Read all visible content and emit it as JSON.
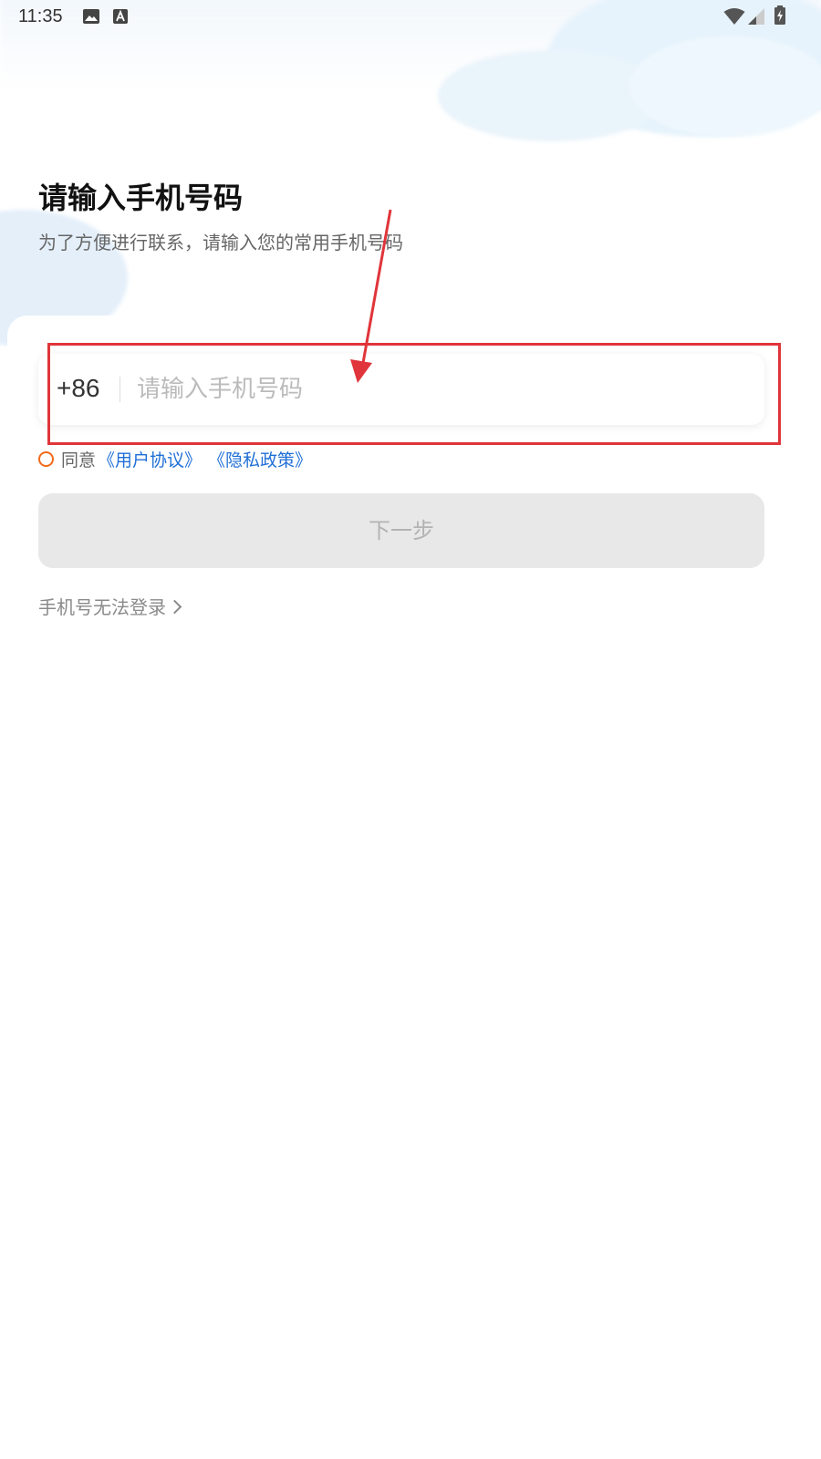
{
  "status_bar": {
    "time": "11:35",
    "icons": [
      "image-icon",
      "text-a-icon",
      "wifi-icon",
      "signal-icon",
      "battery-icon"
    ]
  },
  "header": {
    "title": "请输入手机号码",
    "subtitle": "为了方便进行联系，请输入您的常用手机号码"
  },
  "phone_input": {
    "country_code": "+86",
    "placeholder": "请输入手机号码",
    "value": ""
  },
  "agreement": {
    "checked": false,
    "prefix": "同意",
    "user_agreement": "《用户协议》",
    "privacy_policy": "《隐私政策》"
  },
  "next_button": {
    "label": "下一步",
    "enabled": false
  },
  "help": {
    "label": "手机号无法登录"
  },
  "colors": {
    "accent_link": "#1f6fd6",
    "radio_orange": "#f26a1b",
    "annotation_red": "#e0353a",
    "disabled_button": "#e8e8e8"
  }
}
